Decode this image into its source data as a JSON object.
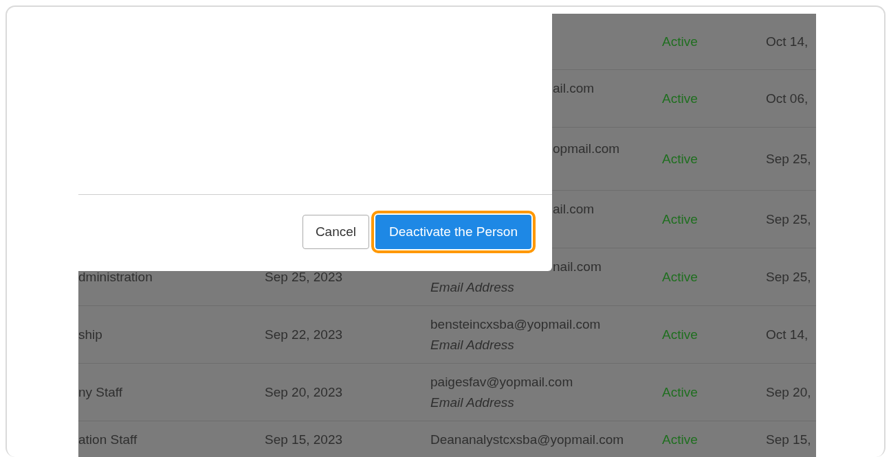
{
  "dialog": {
    "buttons": [
      {
        "label": "Cancel",
        "kind": "secondary",
        "focused": false
      },
      {
        "label": "Deactivate the Person",
        "kind": "primary",
        "focused": true
      }
    ]
  },
  "table": {
    "rows": [
      {
        "column_1": "",
        "column_2": "",
        "email": "",
        "email_label": "",
        "status": "Active",
        "column_5": "Oct 14,"
      },
      {
        "column_1": "",
        "column_2": "",
        "email": "ail.com",
        "email_label": "",
        "status": "Active",
        "column_5": "Oct 06,",
        "partly_hidden": true
      },
      {
        "column_1": "",
        "column_2": "",
        "email": "opmail.com",
        "email_label": "",
        "status": "Active",
        "column_5": "Sep 25,",
        "partly_hidden": true
      },
      {
        "column_1": "",
        "column_2": "",
        "email": "ail.com",
        "email_label": "",
        "status": "Active",
        "column_5": "Sep 25,",
        "partly_hidden": true
      },
      {
        "column_1": "dministration",
        "column_2": "Sep 25, 2023",
        "email": "nail.com",
        "email_label": "Email Address",
        "status": "Active",
        "column_5": "Sep 25,",
        "partly_hidden": true
      },
      {
        "column_1": "ship",
        "column_2": "Sep 22, 2023",
        "email": "bensteincxsba@yopmail.com",
        "email_label": "Email Address",
        "status": "Active",
        "column_5": "Oct 14,",
        "partly_hidden": false
      },
      {
        "column_1": "ny Staff",
        "column_2": "Sep 20, 2023",
        "email": "paigesfav@yopmail.com",
        "email_label": "Email Address",
        "status": "Active",
        "column_5": "Sep 20,",
        "partly_hidden": false
      },
      {
        "column_1": "ation Staff",
        "column_2": "Sep 15, 2023",
        "email": "Deananalystcxsba@yopmail.com",
        "email_label": "",
        "status": "Active",
        "column_5": "Sep 15,",
        "partly_hidden": false
      }
    ]
  }
}
